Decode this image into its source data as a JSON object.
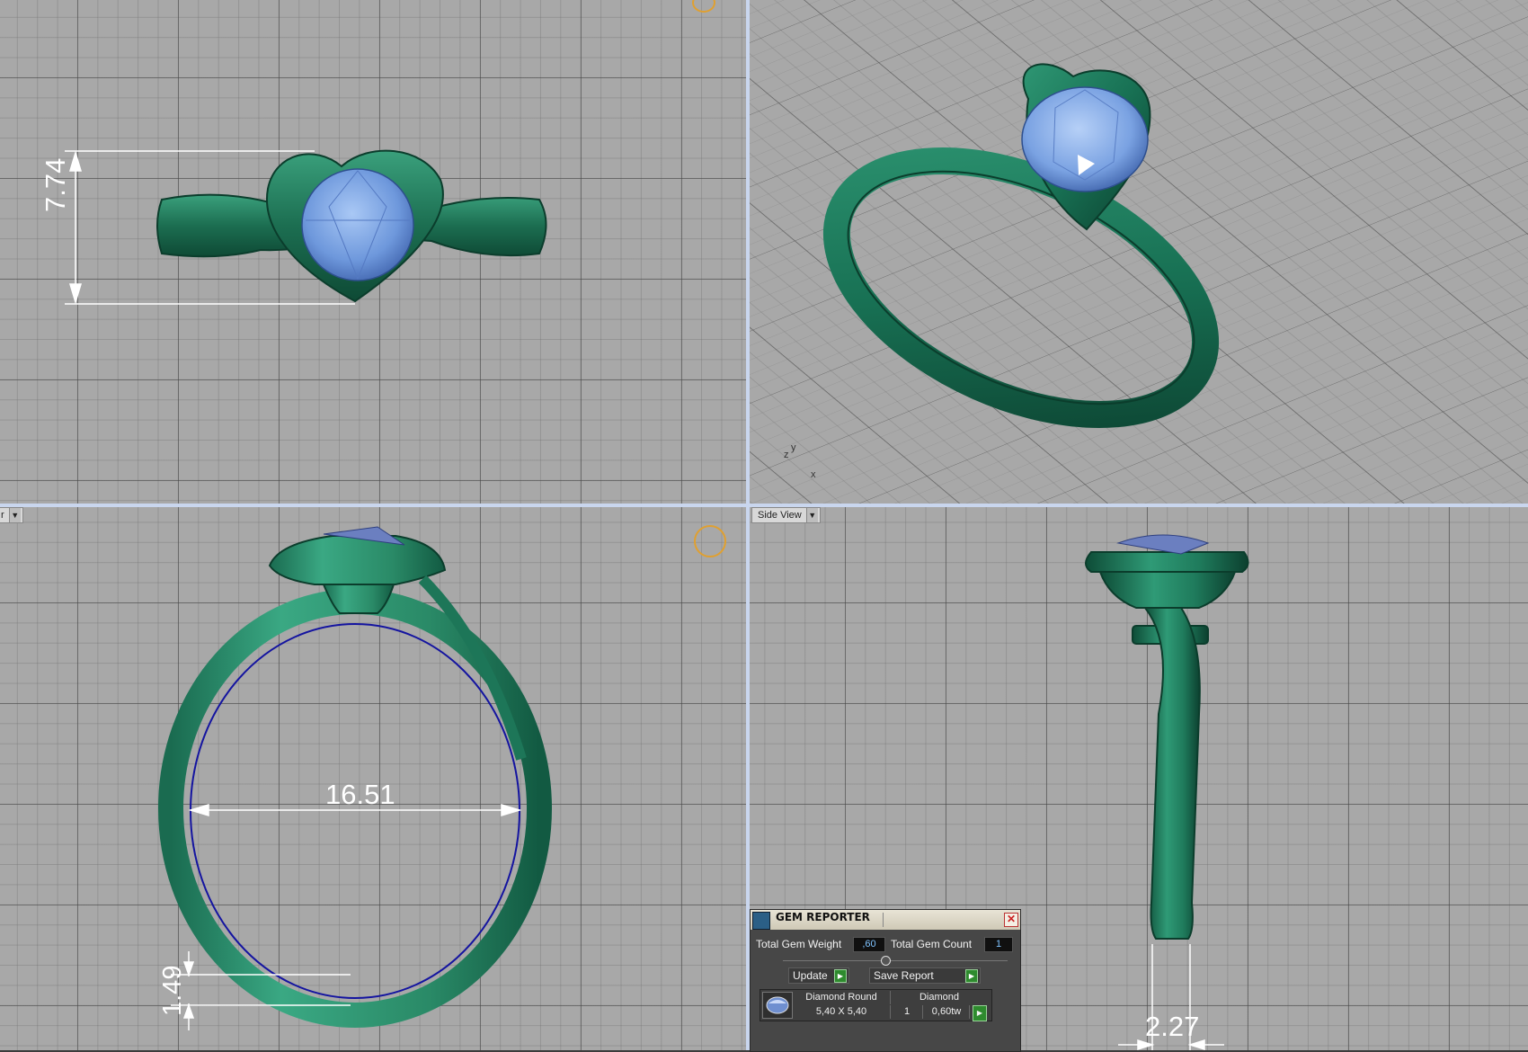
{
  "viewports": {
    "top_left": {
      "dimension_label": "7.74"
    },
    "bottom_left": {
      "view_menu_label": "r",
      "dimension_ring": "16.51",
      "dimension_thickness": "1.49"
    },
    "top_right": {
      "axes": {
        "x": "x",
        "y": "y",
        "z": "z"
      }
    },
    "bottom_right": {
      "view_menu_label": "Side View",
      "dimension_width": "2.27"
    }
  },
  "gem_reporter": {
    "title": "GEM REPORTER",
    "total_gem_weight_label": "Total Gem Weight",
    "total_gem_weight_value": ",60",
    "total_gem_count_label": "Total Gem Count",
    "total_gem_count_value": "1",
    "update_button": "Update",
    "save_report_button": "Save Report",
    "table": {
      "gem_shape": "Diamond Round",
      "material": "Diamond",
      "size": "5,40 X 5,40",
      "count": "1",
      "weight": "0,60tw"
    }
  },
  "colors": {
    "viewport_bg": "#a8a8a8",
    "metal_green": "#1f7a5a",
    "gem_blue": "#7aa7e8",
    "dimension_white": "#ffffff",
    "viewport_border": "#c9d6ee"
  }
}
